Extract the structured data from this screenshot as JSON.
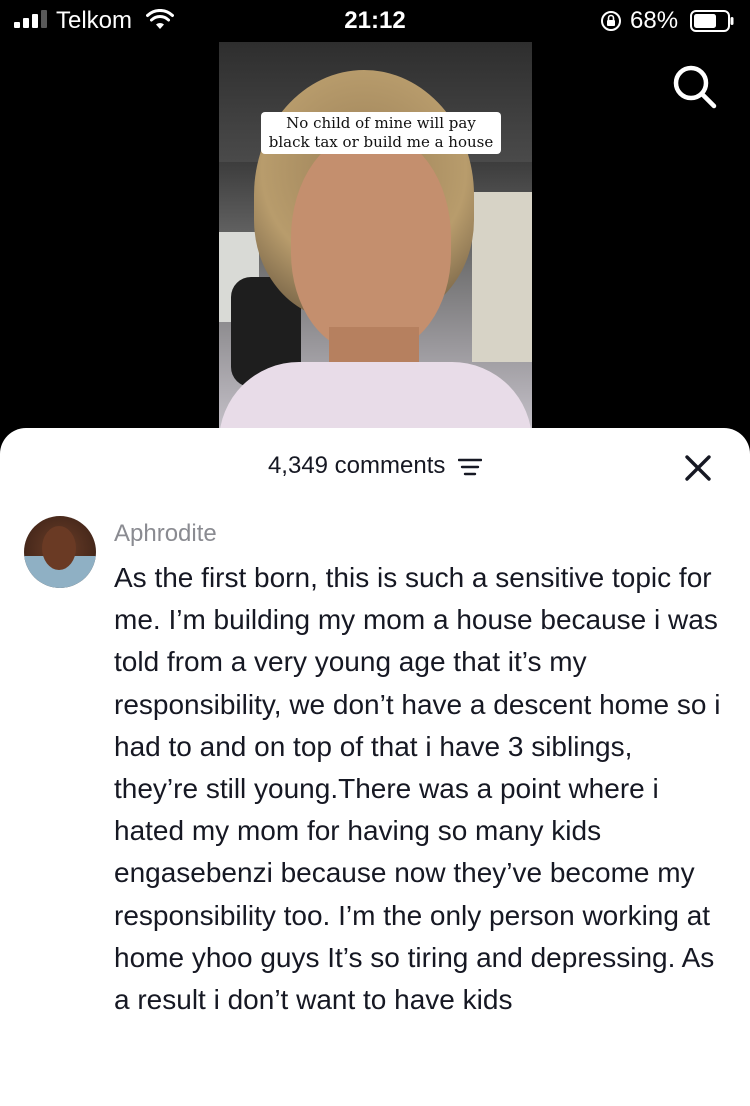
{
  "status_bar": {
    "carrier": "Telkom",
    "time": "21:12",
    "battery_percent": "68%",
    "signal_bars": 3
  },
  "video": {
    "caption": "No child of mine will pay black tax or build me a house"
  },
  "icons": {
    "search": "search-icon",
    "filter": "filter-icon",
    "close": "close-icon"
  },
  "comments_sheet": {
    "count_label": "4,349 comments",
    "comment": {
      "username": "Aphrodite",
      "text": "As the first born, this is such a sensitive topic for me. I’m building my mom a house because i was told from a very young age that it’s my responsibility, we don’t have a descent home so i had to and on top of that i have 3 siblings, they’re still young.There was a point where i hated my mom for having so many kids engasebenzi because now they’ve become my responsibility too. I’m the only person working at home yhoo guys It’s so tiring and depressing. As a result i don’t want to have kids"
    }
  }
}
